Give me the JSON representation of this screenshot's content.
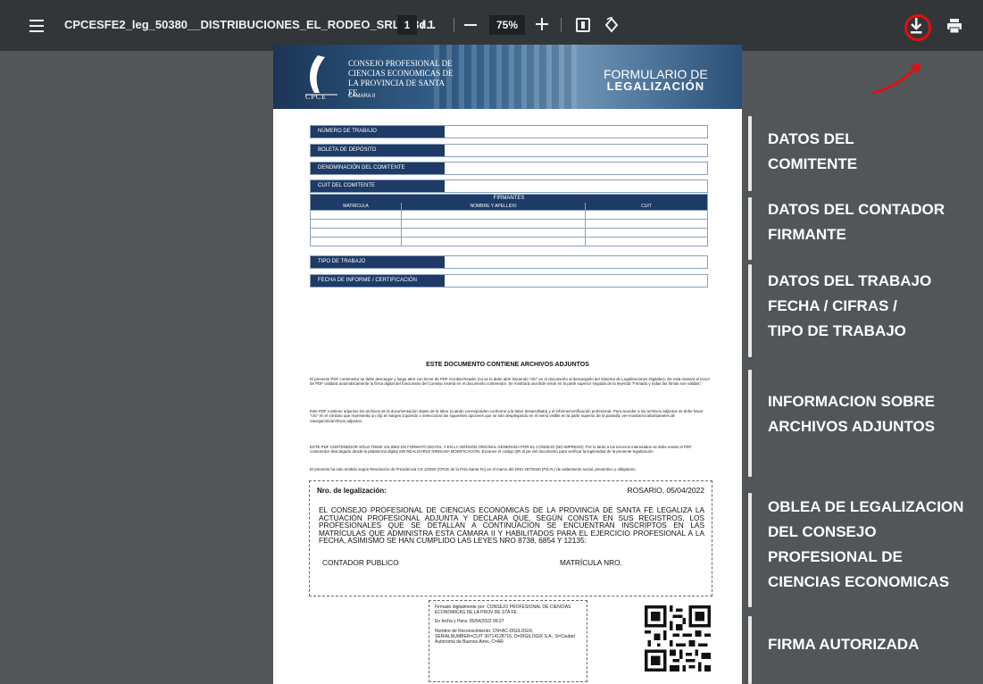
{
  "toolbar": {
    "title": "CPCESFE2_leg_50380__DISTRIBUCIONES_EL_RODEO_SRL__3d...",
    "current_page": "1",
    "page_total": "/ 1",
    "zoom": "75%",
    "icons": [
      "menu-icon",
      "zoom-out-icon",
      "zoom-in-icon",
      "fit-page-icon",
      "rotate-icon",
      "download-icon",
      "print-icon"
    ]
  },
  "document": {
    "org_name": "CONSEJO PROFESIONAL DE CIENCIAS ECONOMICAS DE LA PROVINCIA DE SANTA FE",
    "camara": "CAMARA II",
    "logo_text": "CPCE",
    "form_title_line1": "FORMULARIO DE",
    "form_title_line2": "LEGALIZACIÓN",
    "fields": {
      "numero_trabajo": "NÚMERO DE TRABAJO",
      "boleta": "BOLETA DE DEPÓSITO",
      "denominacion": "DENOMINACIÓN DEL COMITENTE",
      "cuit_comitente": "CUIT DEL COMITENTE",
      "tipo_trabajo": "TIPO DE TRABAJO",
      "fecha_informe": "FECHA DE INFORME / CERTIFICACIÓN"
    },
    "firmantes": {
      "title": "FIRMANTES",
      "col_matricula": "MATRÍCULA",
      "col_nombre": "NOMBRE Y APELLIDO",
      "col_cuit": "CUIT"
    },
    "attachments_title": "ESTE DOCUMENTO CONTIENE ARCHIVOS ADJUNTOS",
    "para1": "El presente PDF contenedor se debe descargar y luego abrir con lector de PDF Acrobat Reader (no se lo debe abrir haciendo \"clic\" en el documento al descargarlo del Sistema de Legalizaciones Digitales). De esta manera el lector de PDF validará automáticamente la firma digital del funcionario del Consejo inserta en el documento contenedor. Se mostrará una tilde verde en la parte superior seguida de la leyenda \"Firmado y todas las firmas son válidas\".",
    "para2": "Este PDF contiene adjuntos los archivos de la documentación objeto de la labor (cuando corresponden conforme a la labor desarrollada) y el informe/certificación profesional. Para acceder a los archivos adjuntos se debe hacer \"clic\" en el símbolo que representa un clip al margen izquierdo o seleccionar las siguientes opciones que se irán desplegando en el menú visible en la parte superior de la pantalla: ver-mostrar/ocultar/paneles de navegación/archivos adjuntos.",
    "para3": "ESTE PDF CONTENEDOR SÓLO TIENE VALIDEZ EN FORMATO DIGITAL Y EN LA VERSIÓN ORIGINAL GENERADA POR EL CONSEJO (NO IMPRESO). Por lo tanto a los terceros interesados se debe enviar el PDF contenedor descargado desde la plataforma digital SIN REALIZARLE NINGUNA MODIFICACIÓN. Escanee el código QR al pie del documento para verificar la legitimidad de la presente legalización.",
    "para4": "El presente ha sido emitido según Resolución de Presidencia CS 1/2020 (CPCE de la Pcia Santa Fe) en el marco del DNU 297/2020 (P.E.N.) de aislamiento social, preventivo y obligatorio.",
    "oblea": {
      "nro_label": "Nro. de legalización:",
      "place_date": "ROSARIO, 05/04/2022",
      "text": "EL CONSEJO PROFESIONAL DE CIENCIAS ECONÓMICAS DE LA PROVINCIA DE SANTA FE LEGALIZA LA ACTUACIÓN PROFESIONAL ADJUNTA Y DECLARA QUE, SEGÚN CONSTA EN SUS REGISTROS, LOS PROFESIONALES QUE SE DETALLAN A CONTINUACIÓN SE ENCUENTRAN INSCRIPTOS EN LAS MATRÍCULAS QUE ADMINISTRA ESTA CÁMARA II Y HABILITADOS PARA EL EJERCICIO PROFESIONAL A LA FECHA, ASIMISMO SE HAN CUMPLIDO LAS LEYES NRO 8738, 6854 Y 12135:",
      "contador": "CONTADOR PUBLICO",
      "matricula": "MATRÍCULA NRO."
    },
    "firma": {
      "line1": "Firmado digitalmente por: CONSEJO PROFESIONAL DE CIENCIAS ECONOMICAS DE LA PROV DE STA FE",
      "line2": "En fecha y Hora: 05/04/2022 09:27",
      "line3": "Nombre de Reconocimiento: CN=AC-DIGILOGIX, SERIALNUMBER=CUIT 30714128716, O=DIGILOGIX S.A., S=Ciudad Autonoma de Buenos Aires, C=AR"
    }
  },
  "annotations": [
    {
      "label": "DATOS DEL\nCOMITENTE"
    },
    {
      "label": "DATOS DEL CONTADOR\nFIRMANTE"
    },
    {
      "label": "DATOS DEL TRABAJO\nFECHA / CIFRAS /\nTIPO DE TRABAJO"
    },
    {
      "label": "INFORMACION SOBRE\nARCHIVOS ADJUNTOS"
    },
    {
      "label": "OBLEA DE LEGALIZACION\nDEL CONSEJO\nPROFESIONAL DE\nCIENCIAS ECONOMICAS"
    },
    {
      "label": "FIRMA AUTORIZADA"
    }
  ],
  "colors": {
    "toolbar": "#323639",
    "viewer_bg": "#525659",
    "form_header": "#1e3a66",
    "highlight": "#e01010"
  }
}
